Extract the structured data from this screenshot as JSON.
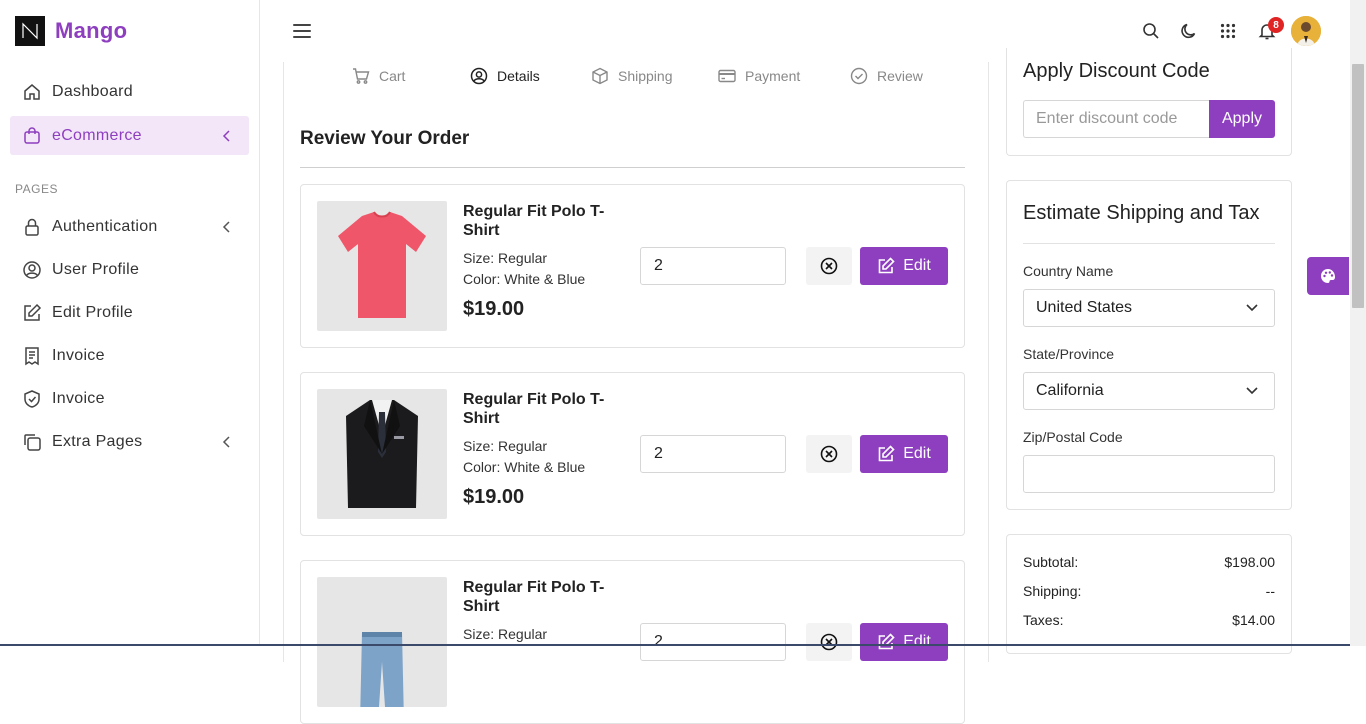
{
  "brand": {
    "name": "Mango"
  },
  "sidebar": {
    "section_label": "PAGES",
    "items": [
      {
        "label": "Dashboard",
        "icon": "home-icon"
      },
      {
        "label": "eCommerce",
        "icon": "shopping-bag-icon",
        "active": true
      },
      {
        "label": "Authentication",
        "icon": "lock-icon"
      },
      {
        "label": "User Profile",
        "icon": "user-circle-icon"
      },
      {
        "label": "Edit Profile",
        "icon": "edit-icon"
      },
      {
        "label": "Invoice",
        "icon": "receipt-icon"
      },
      {
        "label": "Invoice",
        "icon": "shield-check-icon"
      },
      {
        "label": "Extra Pages",
        "icon": "copy-icon"
      }
    ]
  },
  "header": {
    "notification_count": "8"
  },
  "steps": [
    {
      "label": "Cart",
      "icon": "cart-icon"
    },
    {
      "label": "Details",
      "icon": "user-circle-icon",
      "active": true
    },
    {
      "label": "Shipping",
      "icon": "box-icon"
    },
    {
      "label": "Payment",
      "icon": "credit-card-icon"
    },
    {
      "label": "Review",
      "icon": "check-circle-icon"
    }
  ],
  "review": {
    "title": "Review Your Order",
    "edit_label": "Edit",
    "products": [
      {
        "name": "Regular Fit Polo T-Shirt",
        "size": "Size: Regular",
        "color": "Color: White & Blue",
        "price": "$19.00",
        "qty": "2",
        "image": "red-tshirt"
      },
      {
        "name": "Regular Fit Polo T-Shirt",
        "size": "Size: Regular",
        "color": "Color: White & Blue",
        "price": "$19.00",
        "qty": "2",
        "image": "black-suit"
      },
      {
        "name": "Regular Fit Polo T-Shirt",
        "size": "Size: Regular",
        "color": "",
        "price": "",
        "qty": "2",
        "image": "blue-jeans"
      }
    ]
  },
  "discount": {
    "title": "Apply Discount Code",
    "placeholder": "Enter discount code",
    "apply_label": "Apply"
  },
  "shipping": {
    "title": "Estimate Shipping and Tax",
    "country_label": "Country Name",
    "country_value": "United States",
    "state_label": "State/Province",
    "state_value": "California",
    "zip_label": "Zip/Postal Code"
  },
  "summary": {
    "subtotal_label": "Subtotal:",
    "subtotal_value": "$198.00",
    "shipping_label": "Shipping:",
    "shipping_value": "--",
    "taxes_label": "Taxes:",
    "taxes_value": "$14.00"
  },
  "colors": {
    "accent": "#8e3fbf",
    "accent_light": "#f2e6f8",
    "badge": "#e02424"
  }
}
